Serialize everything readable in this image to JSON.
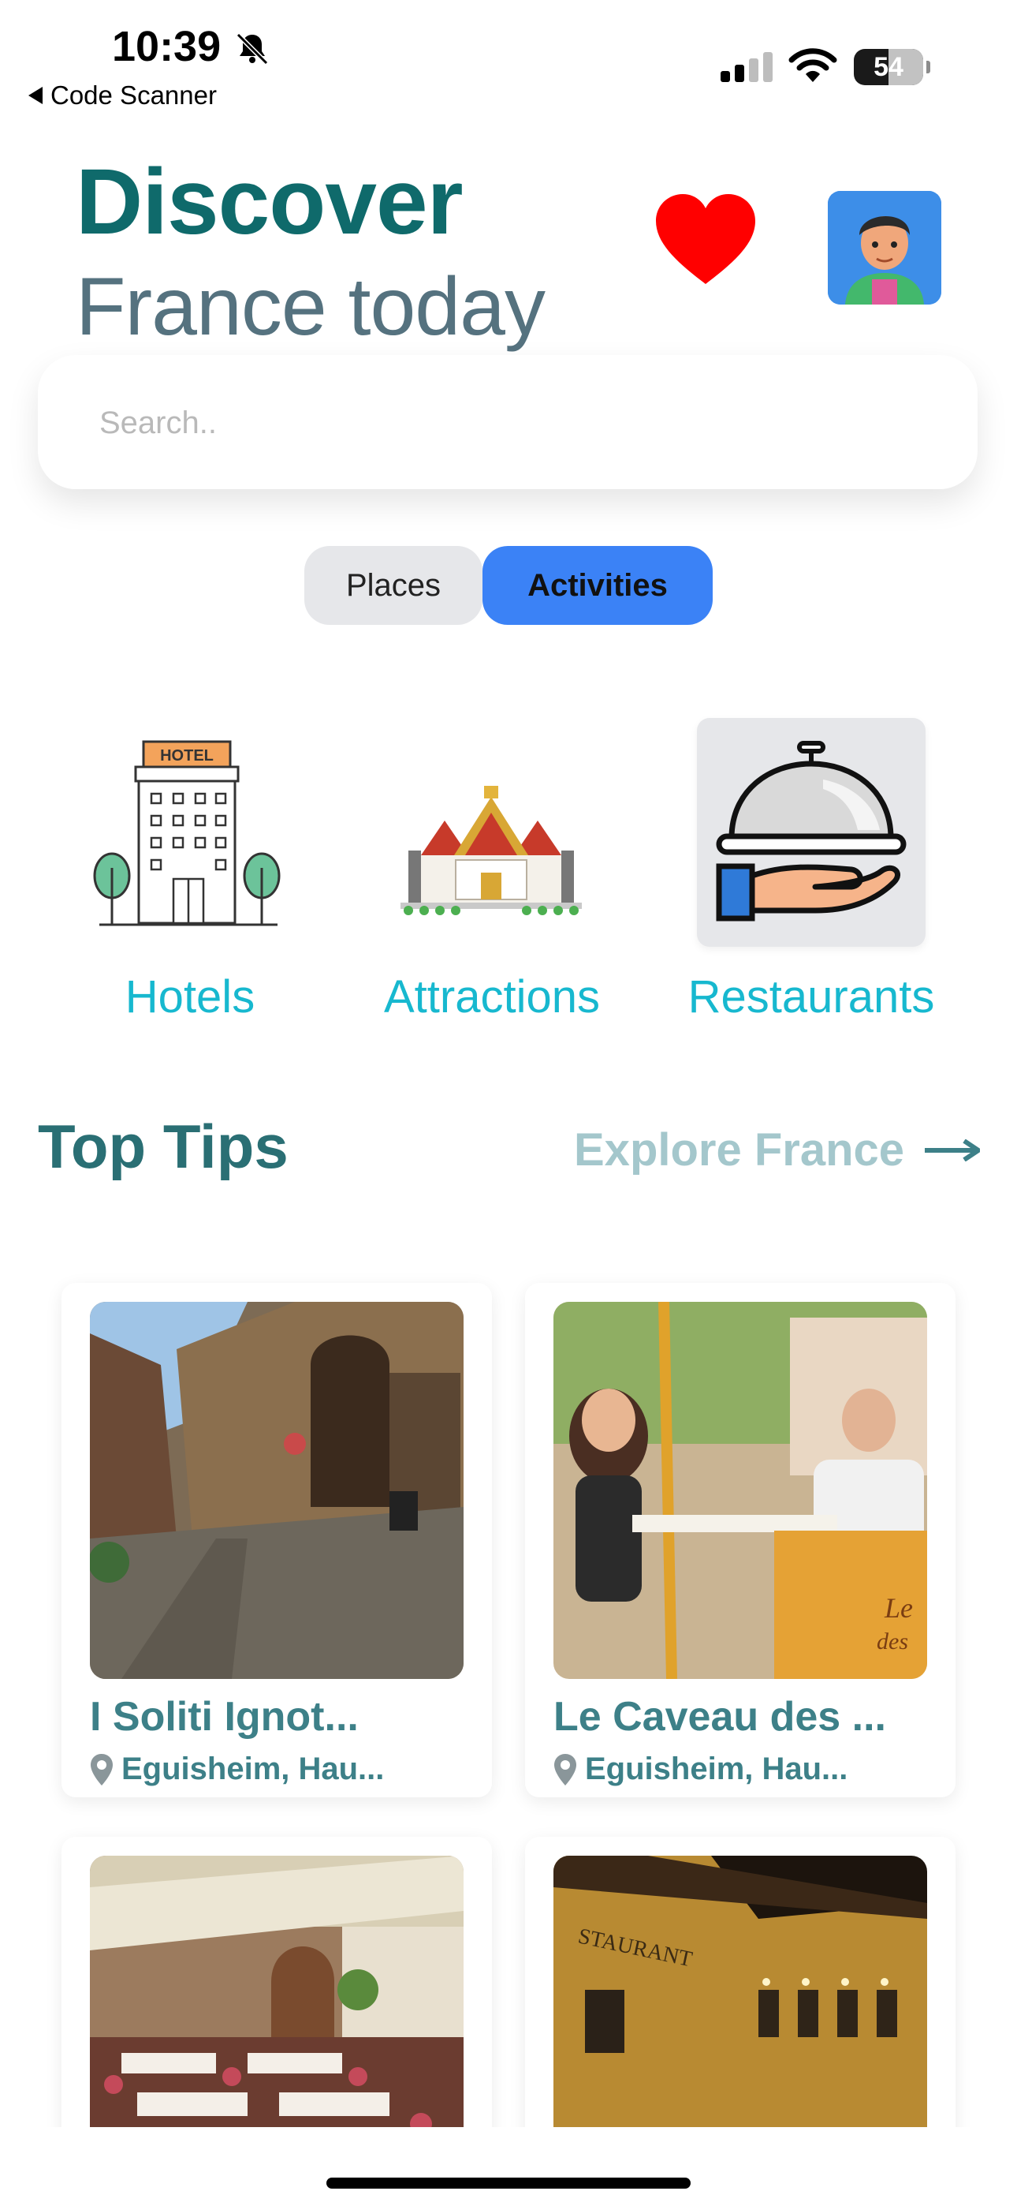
{
  "status_bar": {
    "time": "10:39",
    "back_label": "Code Scanner",
    "battery": "54"
  },
  "header": {
    "title": "Discover",
    "subtitle": "France today"
  },
  "search": {
    "placeholder": "Search.."
  },
  "tabs": [
    {
      "label": "Places",
      "selected": false
    },
    {
      "label": "Activities",
      "selected": true
    }
  ],
  "categories": [
    {
      "label": "Hotels",
      "icon": "hotel-icon",
      "selected": false
    },
    {
      "label": "Attractions",
      "icon": "temple-icon",
      "selected": false
    },
    {
      "label": "Restaurants",
      "icon": "cloche-icon",
      "selected": true
    }
  ],
  "tips": {
    "heading": "Top Tips",
    "explore_label": "Explore France"
  },
  "cards": [
    {
      "title": "I Soliti Ignot...",
      "location": "Eguisheim, Hau..."
    },
    {
      "title": "Le Caveau des ...",
      "location": "Eguisheim, Hau..."
    },
    {
      "title": "",
      "location": ""
    },
    {
      "title": "",
      "location": ""
    }
  ],
  "colors": {
    "title": "#0f6a6b",
    "accent_blue": "#3b82f6",
    "category_text": "#17b8cf",
    "card_text": "#3d8088",
    "heart": "#ff0000"
  }
}
